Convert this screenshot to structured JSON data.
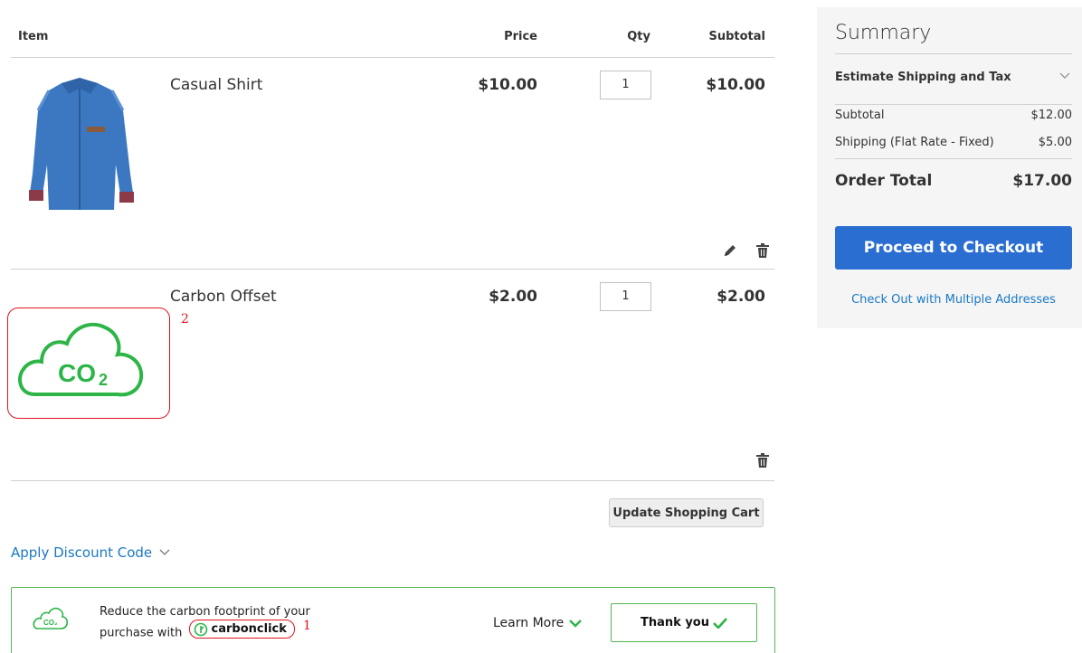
{
  "cart": {
    "headers": {
      "item": "Item",
      "price": "Price",
      "qty": "Qty",
      "subtotal": "Subtotal"
    },
    "items": [
      {
        "name": "Casual Shirt",
        "price": "$10.00",
        "qty": "1",
        "subtotal": "$10.00",
        "image_icon": "blue-shirt-image"
      },
      {
        "name": "Carbon Offset",
        "price": "$2.00",
        "qty": "1",
        "subtotal": "$2.00",
        "image_icon": "co2-cloud-icon",
        "image_text": "CO2"
      }
    ],
    "update_label": "Update Shopping Cart",
    "discount_label": "Apply Discount Code"
  },
  "annotations": {
    "marker_1": "1",
    "marker_2": "2"
  },
  "carbon": {
    "icon_text": "CO2",
    "line1": "Reduce the carbon footprint of your",
    "line2": "purchase with",
    "brand": "carbonclick",
    "learn_more": "Learn More",
    "thank_you": "Thank you"
  },
  "summary": {
    "title": "Summary",
    "estimate_label": "Estimate Shipping and Tax",
    "subtotal_label": "Subtotal",
    "subtotal_value": "$12.00",
    "shipping_label": "Shipping (Flat Rate - Fixed)",
    "shipping_value": "$5.00",
    "total_label": "Order Total",
    "total_value": "$17.00",
    "checkout_label": "Proceed to Checkout",
    "multi_label": "Check Out with Multiple Addresses"
  },
  "colors": {
    "link": "#1979c3",
    "checkout": "#2b6ed2",
    "green": "#2db548",
    "annotation": "#e0141e",
    "summary_bg": "#f5f5f5"
  }
}
